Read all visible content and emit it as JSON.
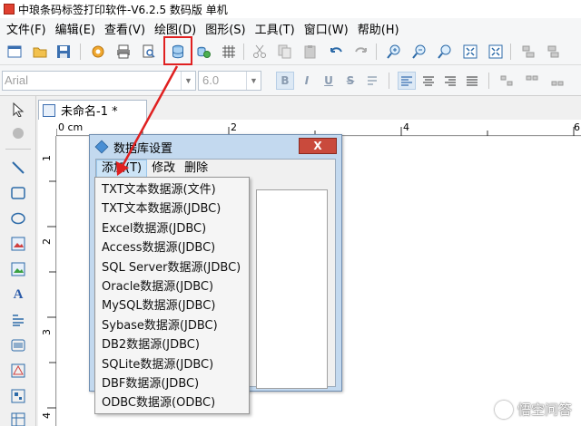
{
  "window": {
    "title": "中琅条码标签打印软件-V6.2.5 数码版 单机"
  },
  "menubar": {
    "items": [
      "文件(F)",
      "编辑(E)",
      "查看(V)",
      "绘图(D)",
      "图形(S)",
      "工具(T)",
      "窗口(W)",
      "帮助(H)"
    ]
  },
  "toolbar2": {
    "font_value": "Arial",
    "size_value": "6.0",
    "bold": "B",
    "italic": "I",
    "underline": "U",
    "strike": "S"
  },
  "document": {
    "tab_label": "未命名-1 *"
  },
  "ruler": {
    "unit": "0 cm",
    "h_numbers": [
      "2",
      "4",
      "6"
    ],
    "v_numbers": [
      "1",
      "2",
      "3",
      "4"
    ]
  },
  "dialog": {
    "title": "数据库设置",
    "close_label": "X",
    "menu": [
      "添加(T)",
      "修改",
      "删除"
    ]
  },
  "dropdown": {
    "items": [
      "TXT文本数据源(文件)",
      "TXT文本数据源(JDBC)",
      "Excel数据源(JDBC)",
      "Access数据源(JDBC)",
      "SQL Server数据源(JDBC)",
      "Oracle数据源(JDBC)",
      "MySQL数据源(JDBC)",
      "Sybase数据源(JDBC)",
      "DB2数据源(JDBC)",
      "SQLite数据源(JDBC)",
      "DBF数据源(JDBC)",
      "ODBC数据源(ODBC)"
    ]
  },
  "watermark": {
    "text": "悟空问答"
  },
  "colors": {
    "highlight": "#e02020",
    "dialog_frame": "#c3d9ef",
    "close_button": "#c94a3c"
  }
}
